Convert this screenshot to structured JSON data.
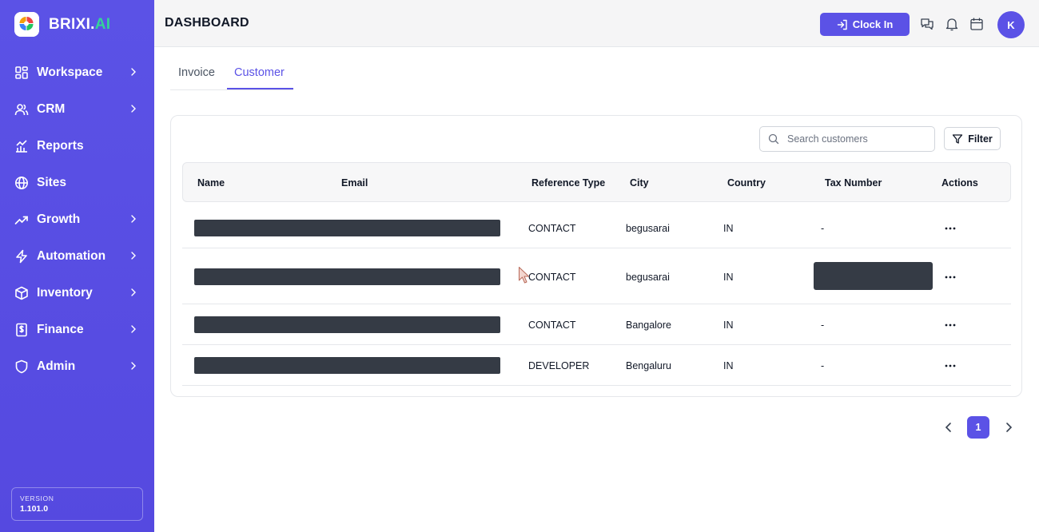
{
  "brand": {
    "name_main": "BRIXI.",
    "name_accent": "AI",
    "accent_color": "#34d399",
    "primary_color": "#5b52e6"
  },
  "sidebar": {
    "items": [
      {
        "label": "Workspace",
        "icon": "grid-icon",
        "has_chevron": true
      },
      {
        "label": "CRM",
        "icon": "users-icon",
        "has_chevron": true
      },
      {
        "label": "Reports",
        "icon": "chart-icon",
        "has_chevron": false
      },
      {
        "label": "Sites",
        "icon": "globe-icon",
        "has_chevron": false
      },
      {
        "label": "Growth",
        "icon": "trending-up-icon",
        "has_chevron": true
      },
      {
        "label": "Automation",
        "icon": "lightning-icon",
        "has_chevron": true
      },
      {
        "label": "Inventory",
        "icon": "box-icon",
        "has_chevron": true
      },
      {
        "label": "Finance",
        "icon": "dollar-doc-icon",
        "has_chevron": true
      },
      {
        "label": "Admin",
        "icon": "shield-icon",
        "has_chevron": true
      }
    ],
    "version_label": "VERSION",
    "version_value": "1.101.0"
  },
  "header": {
    "title": "DASHBOARD",
    "clock_in_label": "Clock In",
    "avatar_initial": "K"
  },
  "tabs": [
    {
      "label": "Invoice",
      "active": false
    },
    {
      "label": "Customer",
      "active": true
    }
  ],
  "toolbar": {
    "search_placeholder": "Search customers",
    "filter_label": "Filter"
  },
  "table": {
    "columns": [
      "Name",
      "Email",
      "Reference Type",
      "City",
      "Country",
      "Tax Number",
      "Actions"
    ],
    "rows": [
      {
        "name": "",
        "email": "",
        "reference_type": "CONTACT",
        "city": "begusarai",
        "country": "IN",
        "tax_number": "-"
      },
      {
        "name": "",
        "email": "",
        "reference_type": "CONTACT",
        "city": "begusarai",
        "country": "IN",
        "tax_number": ""
      },
      {
        "name": "",
        "email": "",
        "reference_type": "CONTACT",
        "city": "Bangalore",
        "country": "IN",
        "tax_number": "-"
      },
      {
        "name": "",
        "email": "",
        "reference_type": "DEVELOPER",
        "city": "Bengaluru",
        "country": "IN",
        "tax_number": "-"
      }
    ]
  },
  "pagination": {
    "current_page": "1"
  }
}
